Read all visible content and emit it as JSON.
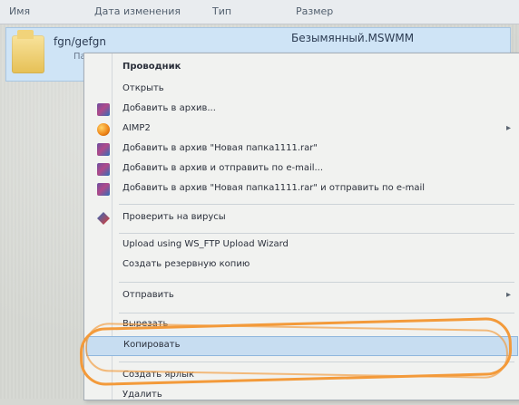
{
  "header": {
    "name": "Имя",
    "date": "Дата изменения",
    "type": "Тип",
    "size": "Размер"
  },
  "file": {
    "name": "fgn/gefgn",
    "subtitle": "Пап",
    "size_text": "Безымянный.MSWMM"
  },
  "menu": {
    "items": [
      {
        "label": "Проводник",
        "bold": true,
        "icon": "",
        "has_submenu": false
      },
      {
        "label": "Открыть",
        "icon": "",
        "has_submenu": false
      },
      {
        "label": "Добавить в архив...",
        "icon": "winrar-icon",
        "has_submenu": false
      },
      {
        "label": "AIMP2",
        "icon": "aimp-icon",
        "has_submenu": true
      },
      {
        "label": "Добавить в архив \"Новая папка1111.rar\"",
        "icon": "winrar-icon",
        "has_submenu": false
      },
      {
        "label": "Добавить в архив и отправить по e-mail...",
        "icon": "winrar-icon",
        "has_submenu": false
      },
      {
        "label": "Добавить в архив \"Новая папка1111.rar\" и отправить по e-mail",
        "icon": "winrar-icon",
        "has_submenu": false
      },
      {
        "label": "Проверить на вирусы",
        "icon": "antivirus-icon",
        "has_submenu": false
      },
      {
        "label": "Upload using WS_FTP Upload Wizard",
        "icon": "",
        "has_submenu": false
      },
      {
        "label": "Создать резервную копию",
        "icon": "",
        "has_submenu": false
      },
      {
        "label": "Отправить",
        "icon": "",
        "has_submenu": true
      },
      {
        "label": "Вырезать",
        "icon": "",
        "has_submenu": false
      },
      {
        "label": "Копировать",
        "icon": "",
        "has_submenu": false,
        "highlighted": true
      },
      {
        "label": "Создать ярлык",
        "icon": "",
        "has_submenu": false
      },
      {
        "label": "Удалить",
        "icon": "",
        "has_submenu": false
      }
    ]
  },
  "colors": {
    "highlight": "#f39a3a",
    "selection": "#c7ddf1"
  }
}
